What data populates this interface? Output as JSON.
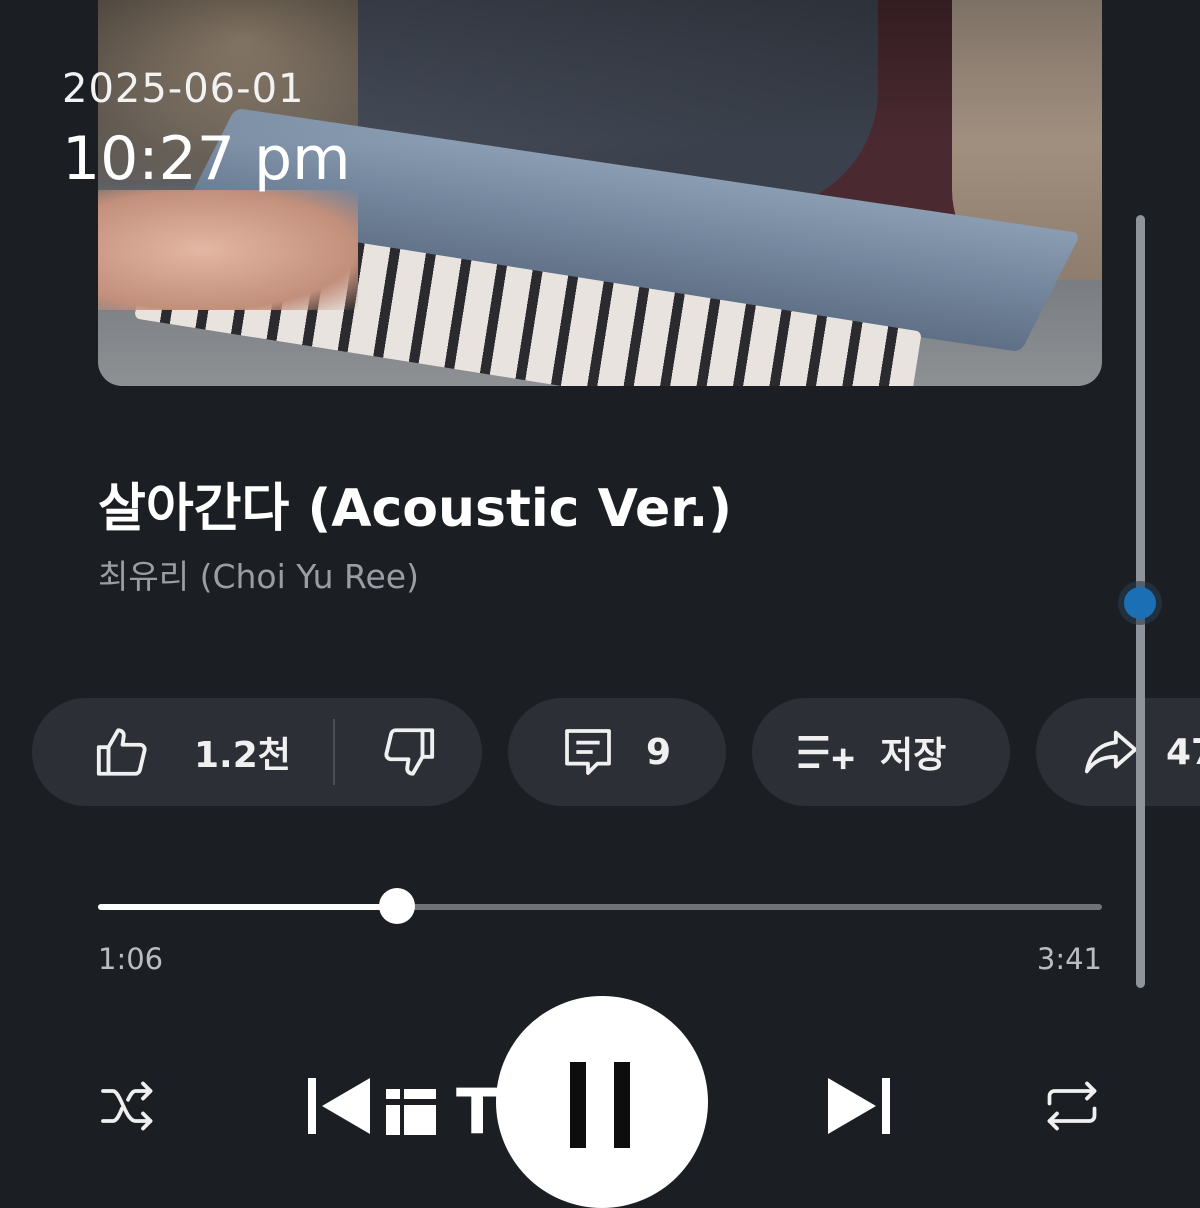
{
  "status": {
    "date": "2025-06-01",
    "time": "10:27 pm"
  },
  "track": {
    "title": "살아간다 (Acoustic Ver.)",
    "artist": "최유리 (Choi Yu Ree)"
  },
  "actions": {
    "like_count": "1.2천",
    "comment_count": "9",
    "save_label": "저장",
    "share_partial": "47"
  },
  "player": {
    "elapsed": "1:06",
    "duration": "3:41",
    "progress_fraction": 0.298,
    "overlay_text": "T    ead"
  },
  "colors": {
    "background": "#1b1f24",
    "pill": "#2c3036",
    "accent": "#1a6fb5"
  },
  "icons": [
    "thumbs-up-icon",
    "thumbs-down-icon",
    "comment-icon",
    "playlist-add-icon",
    "share-icon",
    "shuffle-icon",
    "skip-previous-icon",
    "threads-icon",
    "pause-icon",
    "skip-next-icon",
    "repeat-icon"
  ]
}
